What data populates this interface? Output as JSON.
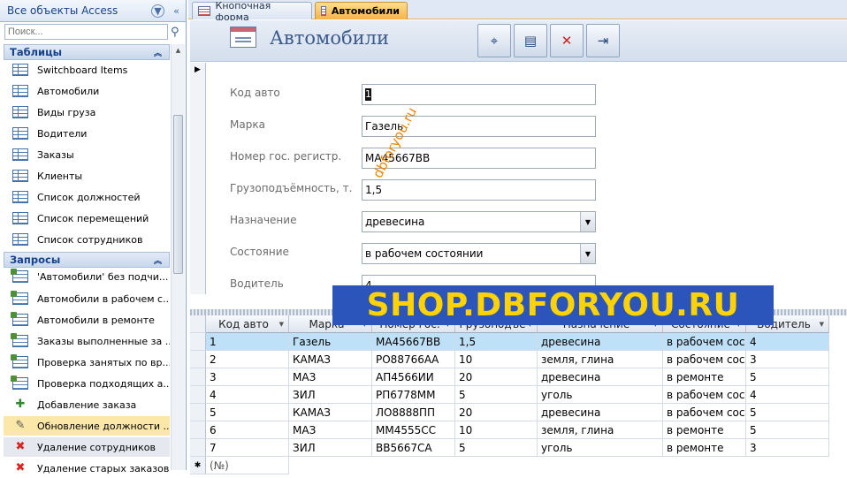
{
  "nav": {
    "title": "Все объекты Access",
    "search_placeholder": "Поиск...",
    "groups": {
      "tables": {
        "title": "Таблицы",
        "items": [
          "Switchboard Items",
          "Автомобили",
          "Виды груза",
          "Водители",
          "Заказы",
          "Клиенты",
          "Список должностей",
          "Список перемещений",
          "Список сотрудников"
        ]
      },
      "queries": {
        "title": "Запросы",
        "items": [
          "'Автомобили' без подчи...",
          "Автомобили в рабочем с...",
          "Автомобили в ремонте",
          "Заказы выполненные за ...",
          "Проверка занятых по вр...",
          "Проверка подходящих а...",
          "Добавление заказа",
          "Обновление должности ...",
          "Удаление сотрудников",
          "Удаление старых заказов"
        ]
      }
    }
  },
  "tabs": [
    {
      "label": "Кнопочная форма",
      "active": false
    },
    {
      "label": "Автомобили",
      "active": true
    }
  ],
  "form": {
    "title": "Автомобили",
    "fields": [
      {
        "label": "Код авто",
        "value": "1"
      },
      {
        "label": "Марка",
        "value": "Газель"
      },
      {
        "label": "Номер гос. регистр.",
        "value": "МА45667ВВ"
      },
      {
        "label": "Грузоподъёмность, т.",
        "value": "1,5"
      },
      {
        "label": "Назначение",
        "value": "древесина"
      },
      {
        "label": "Состояние",
        "value": "в рабочем состоянии"
      },
      {
        "label": "Водитель",
        "value": "4"
      }
    ]
  },
  "watermarks": {
    "diagonal": "dbforyou.ru",
    "banner": "SHOP.DBFORYOU.RU"
  },
  "grid": {
    "headers": [
      "Код авто",
      "Марка",
      "Номер гос.",
      "Грузоподъе",
      "Назначение",
      "Состояние",
      "Водитель"
    ],
    "rows": [
      [
        "1",
        "Газель",
        "МА45667ВВ",
        "1,5",
        "древесина",
        "в рабочем сос",
        "4"
      ],
      [
        "2",
        "КАМАЗ",
        "РО88766АА",
        "10",
        "земля, глина",
        "в рабочем сос",
        "3"
      ],
      [
        "3",
        "МАЗ",
        "АП4566ИИ",
        "20",
        "древесина",
        "в ремонте",
        "5"
      ],
      [
        "4",
        "ЗИЛ",
        "РП6778ММ",
        "5",
        "уголь",
        "в рабочем сос",
        "4"
      ],
      [
        "5",
        "КАМАЗ",
        "ЛО8888ПП",
        "20",
        "древесина",
        "в рабочем сос",
        "5"
      ],
      [
        "6",
        "МАЗ",
        "ММ4555СС",
        "10",
        "земля, глина",
        "в ремонте",
        "5"
      ],
      [
        "7",
        "ЗИЛ",
        "ВВ5667СА",
        "5",
        "уголь",
        "в ремонте",
        "3"
      ]
    ],
    "new_row": "(№)"
  },
  "colors": {
    "accent": "#f5b44a",
    "banner_bg": "#2b55ba",
    "banner_text": "#ffd200",
    "selection": "#bfe1f7"
  }
}
